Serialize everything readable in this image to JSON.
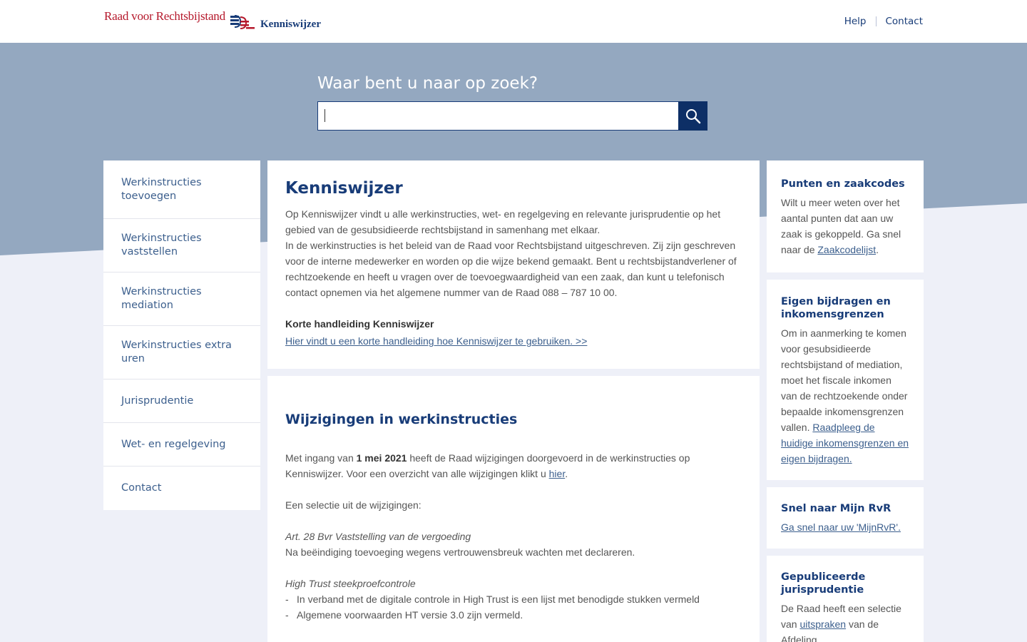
{
  "header": {
    "logo_rvr": "Raad voor Rechtsbijstand",
    "logo_kw": "Kenniswijzer",
    "nav": [
      {
        "label": "Help"
      },
      {
        "label": "Contact"
      }
    ]
  },
  "search": {
    "title": "Waar bent u naar op zoek?",
    "value": "",
    "button_icon": "search-icon"
  },
  "sidebar": {
    "items": [
      {
        "label": "Werkinstructies toevoegen"
      },
      {
        "label": "Werkinstructies vaststellen"
      },
      {
        "label": "Werkinstructies mediation"
      },
      {
        "label": "Werkinstructies extra uren"
      },
      {
        "label": "Jurisprudentie"
      },
      {
        "label": "Wet- en regelgeving"
      },
      {
        "label": "Contact"
      }
    ]
  },
  "intro": {
    "title": "Kenniswijzer",
    "para1": "Op Kenniswijzer vindt u alle werkinstructies, wet- en regelgeving en relevante jurisprudentie op het gebied van de gesubsidieerde rechtsbijstand in samenhang met elkaar.",
    "para2": "In de werkinstructies is het beleid van de Raad voor Rechtsbijstand uitgeschreven. Zij zijn geschreven voor de interne medewerker en worden op die wijze bekend gemaakt. Bent u rechtsbijstandverlener of rechtzoekende en heeft u vragen over de toevoegwaardigheid van een zaak, dan kunt u telefonisch contact opnemen via het algemene nummer van de Raad 088 – 787 10 00.",
    "manual_heading": "Korte handleiding Kenniswijzer",
    "manual_link": "Hier vindt u een korte handleiding hoe Kenniswijzer te gebruiken. >>"
  },
  "changes": {
    "title": "Wijzigingen in werkinstructies",
    "p1_before": "Met ingang van ",
    "p1_date": "1 mei 2021",
    "p1_mid": " heeft de Raad wijzigingen doorgevoerd in de werkinstructies op Kenniswijzer. Voor een overzicht van alle wijzigingen klikt u ",
    "p1_link": "hier",
    "p1_end": ".",
    "selection": "Een selectie uit de wijzigingen:",
    "art_title": "Art. 28 Bvr Vaststelling van de vergoeding",
    "art_text": "Na beëindiging toevoeging wegens vertrouwensbreuk wachten met declareren.",
    "ht_title": "High Trust steekproefcontrole",
    "bullets": [
      "In verband met de digitale controle in High Trust is een lijst met benodigde stukken vermeld",
      "Algemene voorwaarden HT versie 3.0 zijn vermeld."
    ],
    "bullet_marker": "-"
  },
  "right": {
    "card1": {
      "title": "Punten en zaakcodes",
      "text": "Wilt u meer weten over het aantal punten dat aan uw zaak is gekoppeld. Ga snel naar de ",
      "link": "Zaakcodelijst",
      "end": "."
    },
    "card2": {
      "title": "Eigen bijdragen en inkomensgrenzen",
      "text": "Om in aanmerking te komen voor gesubsidieerde rechtsbijstand of mediation, moet het fiscale inkomen van de rechtzoekende onder bepaalde inkomensgrenzen vallen. ",
      "link": "Raadpleeg de huidige inkomensgrenzen en eigen bijdragen."
    },
    "card3": {
      "title": "Snel naar Mijn RvR",
      "link": "Ga snel naar uw 'MijnRvR'."
    },
    "card4": {
      "title": "Gepubliceerde jurisprudentie",
      "text": "De Raad heeft een selectie van ",
      "link": "uitspraken",
      "end": " van de Afdeling"
    }
  },
  "colors": {
    "hero": "#94a8c0",
    "navy": "#183c78",
    "search_button": "#0d2f66",
    "brand_red": "#b5182b",
    "link": "#3c5f8d"
  }
}
